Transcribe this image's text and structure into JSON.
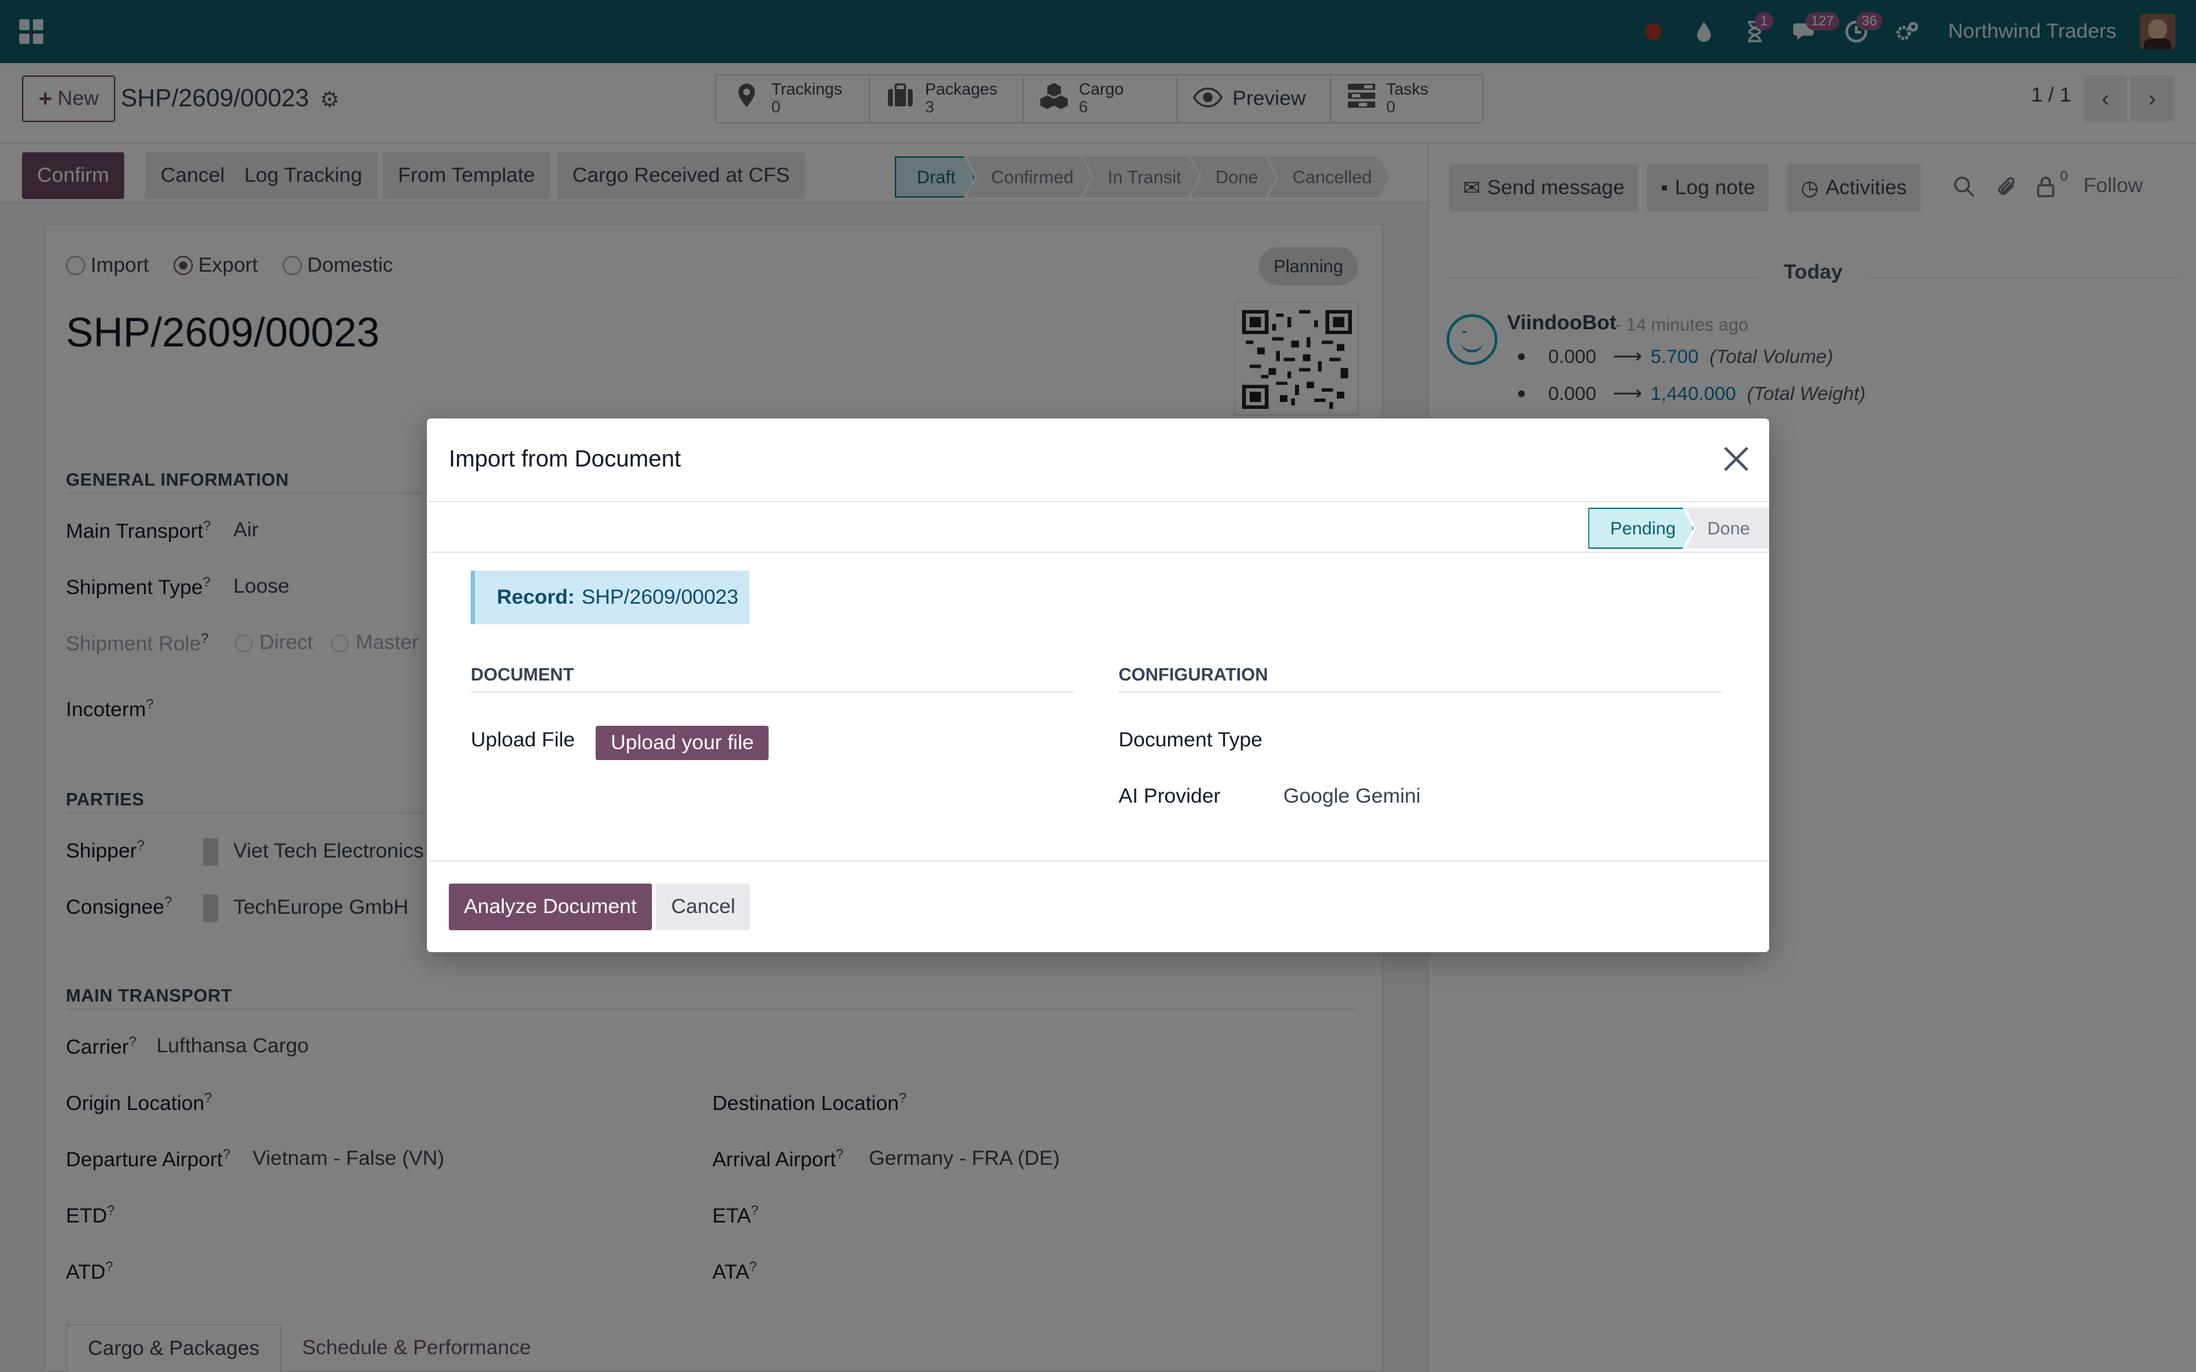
{
  "navbar": {
    "company": "Northwind Traders",
    "badges": {
      "activities_clock": "1",
      "messages": "127",
      "activities": "36"
    },
    "colors": {
      "bar": "#0e5f6b",
      "badge": "#a05b8f"
    }
  },
  "control_panel": {
    "new_label": "New",
    "record_name": "SHP/2609/00023",
    "smart_buttons": [
      {
        "label": "Trackings",
        "value": "0",
        "icon": "map-pin-icon"
      },
      {
        "label": "Packages",
        "value": "3",
        "icon": "suitcase-icon"
      },
      {
        "label": "Cargo",
        "value": "6",
        "icon": "boxes-icon"
      },
      {
        "label": "Preview",
        "icon": "eye-icon"
      },
      {
        "label": "Tasks",
        "value": "0",
        "icon": "tasks-icon"
      }
    ],
    "pager": "1 / 1"
  },
  "statusbar": {
    "buttons": [
      "Confirm",
      "Cancel",
      "Log Tracking",
      "From Template",
      "Cargo Received at CFS"
    ],
    "stages": [
      "Draft",
      "Confirmed",
      "In Transit",
      "Done",
      "Cancelled"
    ],
    "active_stage": "Draft"
  },
  "form": {
    "direction_options": [
      "Import",
      "Export",
      "Domestic"
    ],
    "direction_selected": "Export",
    "planning_badge": "Planning",
    "title": "SHP/2609/00023",
    "general_section": "GENERAL INFORMATION",
    "main_transport_label": "Main Transport",
    "main_transport_value": "Air",
    "shipment_type_label": "Shipment Type",
    "shipment_type_value": "Loose",
    "shipment_role_label": "Shipment Role",
    "shipment_role_options": [
      "Direct",
      "Master"
    ],
    "incoterm_label": "Incoterm",
    "parties_section": "PARTIES",
    "shipper_label": "Shipper",
    "shipper_value": "Viet Tech Electronics",
    "consignee_label": "Consignee",
    "consignee_value": "TechEurope GmbH",
    "main_transport_section": "MAIN TRANSPORT",
    "carrier_label": "Carrier",
    "carrier_value": "Lufthansa Cargo",
    "origin_label": "Origin Location",
    "destination_label": "Destination Location",
    "departure_label": "Departure Airport",
    "departure_value": "Vietnam - False (VN)",
    "arrival_label": "Arrival Airport",
    "arrival_value": "Germany - FRA (DE)",
    "etd_label": "ETD",
    "eta_label": "ETA",
    "atd_label": "ATD",
    "ata_label": "ATA",
    "help_mark": "?",
    "tabs": [
      "Cargo & Packages",
      "Schedule & Performance"
    ]
  },
  "chatter": {
    "send_message": "Send message",
    "log_note": "Log note",
    "activities": "Activities",
    "followers_count": "0",
    "follow": "Follow",
    "today": "Today",
    "author": "ViindooBot",
    "time": "- 14 minutes ago",
    "changes": [
      {
        "old": "0.000",
        "new": "5.700",
        "field": "(Total Volume)"
      },
      {
        "old": "0.000",
        "new": "1,440.000",
        "field": "(Total Weight)"
      }
    ]
  },
  "modal": {
    "title": "Import from Document",
    "stages": [
      "Pending",
      "Done"
    ],
    "record_label": "Record:",
    "record_value": "SHP/2609/00023",
    "document_section": "DOCUMENT",
    "configuration_section": "CONFIGURATION",
    "upload_file_label": "Upload File",
    "upload_button": "Upload your file",
    "document_type_label": "Document Type",
    "ai_provider_label": "AI Provider",
    "ai_provider_value": "Google Gemini",
    "analyze_button": "Analyze Document",
    "cancel_button": "Cancel"
  }
}
